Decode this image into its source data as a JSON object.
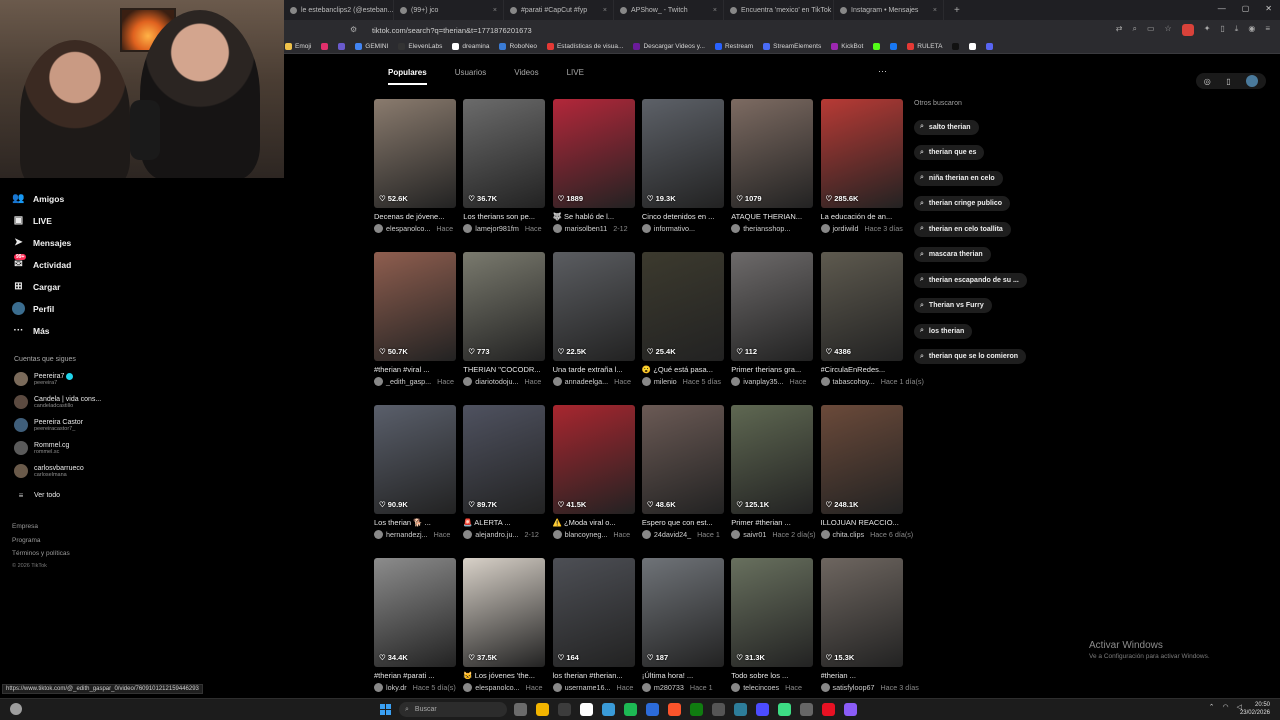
{
  "browser": {
    "tabs": [
      {
        "label": "le estebanclips2 (@esteban..."
      },
      {
        "label": "(99+) jco"
      },
      {
        "label": "#parati #CapCut #fyp"
      },
      {
        "label": "APShow_ - Twitch"
      },
      {
        "label": "Encuentra 'mexico' en TikTok | Busca"
      },
      {
        "label": "Instagram • Mensajes"
      }
    ],
    "url": "tiktok.com/search?q=therian&t=1771876201673",
    "bookmarks": [
      "Emoji",
      "",
      "",
      "GEMINI",
      "ElevenLabs",
      "dreamina",
      "RoboNeo",
      "Estadísticas de visua...",
      "Descargar Videos y...",
      "Restream",
      "StreamElements",
      "KickBot",
      "",
      "",
      "RULETA",
      "",
      "",
      ""
    ],
    "bookmark_colors": [
      "#f0c24a",
      "#e1306c",
      "#6a5acd",
      "#4285f4",
      "#333333",
      "#ffffff",
      "#3a7bd5",
      "#e53935",
      "#6a1b9a",
      "#2962ff",
      "#4a6cf7",
      "#9c27b0",
      "#53fc18",
      "#1877f2",
      "#e53935",
      "#111111",
      "#ffffff",
      "#5865f2"
    ]
  },
  "sidebar": {
    "nav": [
      {
        "label": "Amigos",
        "icon": "friends-icon"
      },
      {
        "label": "LIVE",
        "icon": "live-icon"
      },
      {
        "label": "Mensajes",
        "icon": "messages-icon"
      },
      {
        "label": "Actividad",
        "icon": "activity-icon",
        "badge": "99+"
      },
      {
        "label": "Cargar",
        "icon": "upload-icon"
      },
      {
        "label": "Perfil",
        "icon": "profile-icon"
      },
      {
        "label": "Más",
        "icon": "more-icon"
      }
    ],
    "following_heading": "Cuentas que sigues",
    "following": [
      {
        "name": "Peereira7",
        "handle": "peereira7",
        "verified": true
      },
      {
        "name": "Candela | vida cons...",
        "handle": "candeladcastillo",
        "verified": false
      },
      {
        "name": "Peereira Castor",
        "handle": "peereiracastor7_",
        "verified": false
      },
      {
        "name": "Rommel.cg",
        "handle": "rommel.sc",
        "verified": false
      },
      {
        "name": "carlosvbarrueco",
        "handle": "carloselmana",
        "verified": false
      }
    ],
    "see_all": "Ver todo",
    "footer": [
      "Empresa",
      "Programa",
      "Términos y políticas"
    ],
    "copyright": "© 2026 TikTok"
  },
  "search_tabs": [
    "Populares",
    "Usuarios",
    "Videos",
    "LIVE"
  ],
  "videos": [
    {
      "likes": "52.6K",
      "caption": "Decenas de jóvene...",
      "author": "elespanolco...",
      "when": "Hace",
      "color": "#8a7b6e"
    },
    {
      "likes": "36.7K",
      "caption": "Los therians son pe...",
      "author": "lamejor981fm",
      "when": "Hace",
      "color": "#6b6b6b"
    },
    {
      "likes": "1889",
      "caption": "🐺 Se habló de l...",
      "author": "marisolben11",
      "when": "2-12",
      "color": "#b3273a"
    },
    {
      "likes": "19.3K",
      "caption": "Cinco detenidos en ...",
      "author": "informativo...",
      "when": "",
      "color": "#5d6168"
    },
    {
      "likes": "1079",
      "caption": "ATAQUE THERIAN...",
      "author": "theriansshop...",
      "when": "",
      "color": "#7d6b62"
    },
    {
      "likes": "285.6K",
      "caption": "La educación de an...",
      "author": "jordiwild",
      "when": "Hace 3 días",
      "color": "#b83a35"
    },
    {
      "likes": "50.7K",
      "caption": "#therian #viral ...",
      "author": "_edith_gasp...",
      "when": "Hace",
      "color": "#8f5e4f"
    },
    {
      "likes": "773",
      "caption": "THERIAN \"COCODR...",
      "author": "diariotodoju...",
      "when": "Hace",
      "color": "#7a7a6e"
    },
    {
      "likes": "22.5K",
      "caption": "Una tarde extraña l...",
      "author": "annadeelga...",
      "when": "Hace",
      "color": "#5b5d61"
    },
    {
      "likes": "25.4K",
      "caption": "😮 ¿Qué está pasa...",
      "author": "milenio",
      "when": "Hace 5 días",
      "color": "#3c3a2e"
    },
    {
      "likes": "112",
      "caption": "Primer therians gra...",
      "author": "ivanplay35...",
      "when": "Hace",
      "color": "#6d6a6a"
    },
    {
      "likes": "4386",
      "caption": "#CirculaEnRedes...",
      "author": "tabascohoy...",
      "when": "Hace 1 día(s)",
      "color": "#5e5a4f"
    },
    {
      "likes": "90.9K",
      "caption": "Los therian 🐕 ...",
      "author": "hernandezj...",
      "when": "Hace",
      "color": "#5a5f6b"
    },
    {
      "likes": "89.7K",
      "caption": "🚨 ALERTA ...",
      "author": "alejandro.ju...",
      "when": "2-12",
      "color": "#4f5260"
    },
    {
      "likes": "41.5K",
      "caption": "⚠️ ¿Moda viral o...",
      "author": "blancoyneg...",
      "when": "Hace",
      "color": "#a8262f"
    },
    {
      "likes": "48.6K",
      "caption": "Espero que con est...",
      "author": "24david24_",
      "when": "Hace 1",
      "color": "#6b5a55"
    },
    {
      "likes": "125.1K",
      "caption": "Primer #therian ...",
      "author": "saivr01",
      "when": "Hace 2 día(s)",
      "color": "#5f6852"
    },
    {
      "likes": "248.1K",
      "caption": "ILLOJUAN REACCIO...",
      "author": "chita.clips",
      "when": "Hace 6 día(s)",
      "color": "#6b4a3a"
    },
    {
      "likes": "34.4K",
      "caption": "#therian #parati ...",
      "author": "loky.dr",
      "when": "Hace 5 día(s)",
      "color": "#8c8c8c"
    },
    {
      "likes": "37.5K",
      "caption": "😺 Los jóvenes 'the...",
      "author": "elespanolco...",
      "when": "Hace",
      "color": "#d8d1c8"
    },
    {
      "likes": "164",
      "caption": "los therian #therian...",
      "author": "username16...",
      "when": "Hace",
      "color": "#4d4f55"
    },
    {
      "likes": "187",
      "caption": "¡Última hora! ...",
      "author": "m280733",
      "when": "Hace 1",
      "color": "#6f7378"
    },
    {
      "likes": "31.3K",
      "caption": "Todo sobre los ...",
      "author": "telecincoes",
      "when": "Hace",
      "color": "#68705e"
    },
    {
      "likes": "15.3K",
      "caption": "#therian ...",
      "author": "satisfyloop67",
      "when": "Hace 3 días",
      "color": "#6e6660"
    }
  ],
  "others_title": "Otros buscaron",
  "others": [
    "salto therian",
    "therian que es",
    "niña therian en celo",
    "therian cringe publico",
    "therian en celo toallita",
    "mascara therian",
    "therian escapando de su ...",
    "Therian vs Furry",
    "los therian",
    "therian que se lo comieron"
  ],
  "watermark": {
    "line1": "Activar Windows",
    "line2": "Ve a Configuración para activar Windows."
  },
  "status_url": "https://www.tiktok.com/@_edith_gaspar_0/video/7609101212159446293",
  "taskbar": {
    "search_placeholder": "Buscar",
    "time": "20:50",
    "date": "23/02/2026"
  }
}
